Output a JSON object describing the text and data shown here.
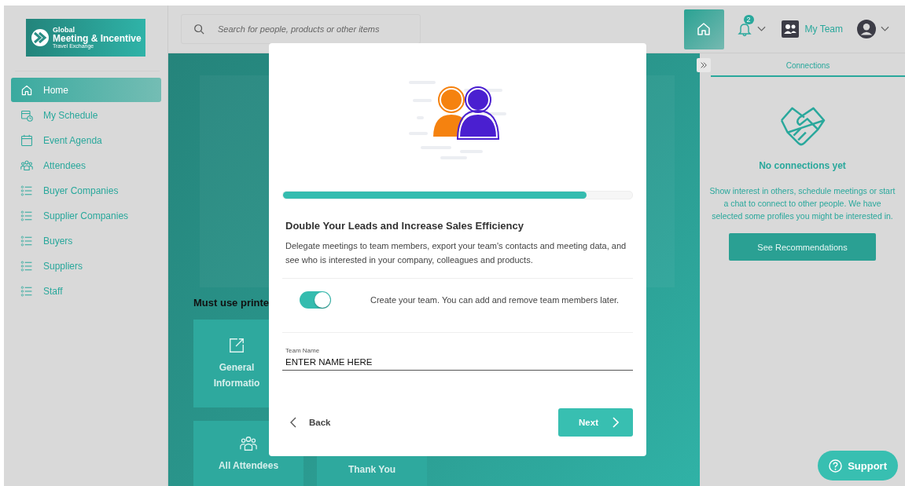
{
  "sidebar": {
    "logo": {
      "line1": "Global",
      "line2": "Meeting & Incentive",
      "line3": "Travel Exchange"
    },
    "items": [
      {
        "label": "Home",
        "kind": "home",
        "selected": true
      },
      {
        "label": "My Schedule",
        "kind": "schedule",
        "selected": false
      },
      {
        "label": "Event Agenda",
        "kind": "agenda",
        "selected": false
      },
      {
        "label": "Attendees",
        "kind": "people",
        "selected": false
      },
      {
        "label": "Buyer Companies",
        "kind": "list",
        "selected": false
      },
      {
        "label": "Supplier Companies",
        "kind": "list",
        "selected": false
      },
      {
        "label": "Buyers",
        "kind": "list",
        "selected": false
      },
      {
        "label": "Suppliers",
        "kind": "list",
        "selected": false
      },
      {
        "label": "Staff",
        "kind": "list",
        "selected": false
      }
    ]
  },
  "topbar": {
    "search": {
      "placeholder": "Search for people, products or other items"
    },
    "notifications": {
      "badge": "2"
    },
    "team": {
      "label": "My Team"
    }
  },
  "main": {
    "heading": "Must use printe",
    "cards": [
      {
        "kind": "link",
        "lines": [
          "General",
          "Informatio"
        ]
      },
      {
        "kind": "people",
        "lines": [
          "All Attendees"
        ]
      },
      {
        "kind": "plain",
        "lines": [
          "Thank You"
        ]
      }
    ]
  },
  "connections": {
    "tab": "Connections",
    "title": "No connections yet",
    "text": "Show interest in others, schedule meetings or start a chat to connect to other people. We have selected some profiles you might be interested in.",
    "button": "See Recommendations"
  },
  "modal": {
    "progress": {
      "level": 0.87
    },
    "title": "Double Your Leads and Increase Sales Efficiency",
    "description": "Delegate meetings to team members, export your team's contacts and meeting data, and see who is interested in your company, colleagues and products.",
    "toggle": {
      "on": true,
      "label": "Create your team. You can add and remove team members later."
    },
    "field": {
      "label": "Team Name",
      "value": "ENTER NAME HERE"
    },
    "back": "Back",
    "next": "Next"
  },
  "support": {
    "label": "Support"
  }
}
